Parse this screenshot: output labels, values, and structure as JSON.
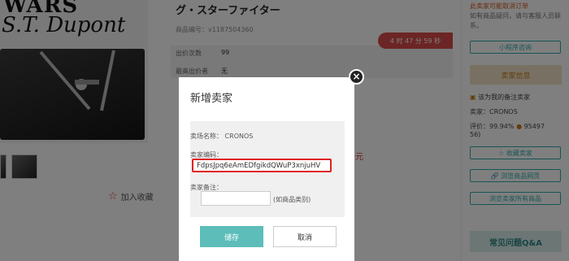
{
  "product": {
    "brand_top": "WARS",
    "brand_name": "S.T. Dupont",
    "title": "グ・スターファイター",
    "item_no": "商品编号：v1187504360",
    "favorite": "加入收藏",
    "stats": [
      {
        "label": "出价次数",
        "value": "99"
      },
      {
        "label": "最高出价者",
        "value": "无"
      }
    ],
    "timer": "4 时 47 分 59 秒",
    "price_fragment": "元"
  },
  "right": {
    "notice_title": "此卖家可能取消订单",
    "notice_sub": "如有商品疑问，请与客服人员联系。",
    "small_btn": "小程序咨询",
    "seller_header": "卖家信息",
    "safe_seller": "该为我的备注卖家",
    "seller_name": "卖家：CRONOS",
    "rating": "评价：99.94%",
    "rating_count": "95497",
    "rating_extra": "56)",
    "follow_btn": "收藏卖家",
    "view_page_btn": "浏览商品网页",
    "view_all_btn": "浏览卖家所有商品",
    "faq": "常见问题Q&A"
  },
  "modal": {
    "title": "新增卖家",
    "close": "×",
    "venue_label": "卖场名称：",
    "venue_value": "CRONOS",
    "key_label": "卖家编码：",
    "key_value": "FdpsJpq6eAmEDfgikdQWuP3xnjuHV",
    "note_label": "卖家备注：",
    "note_value": "",
    "note_hint": "(如商品类别)",
    "save": "储存",
    "cancel": "取消"
  }
}
